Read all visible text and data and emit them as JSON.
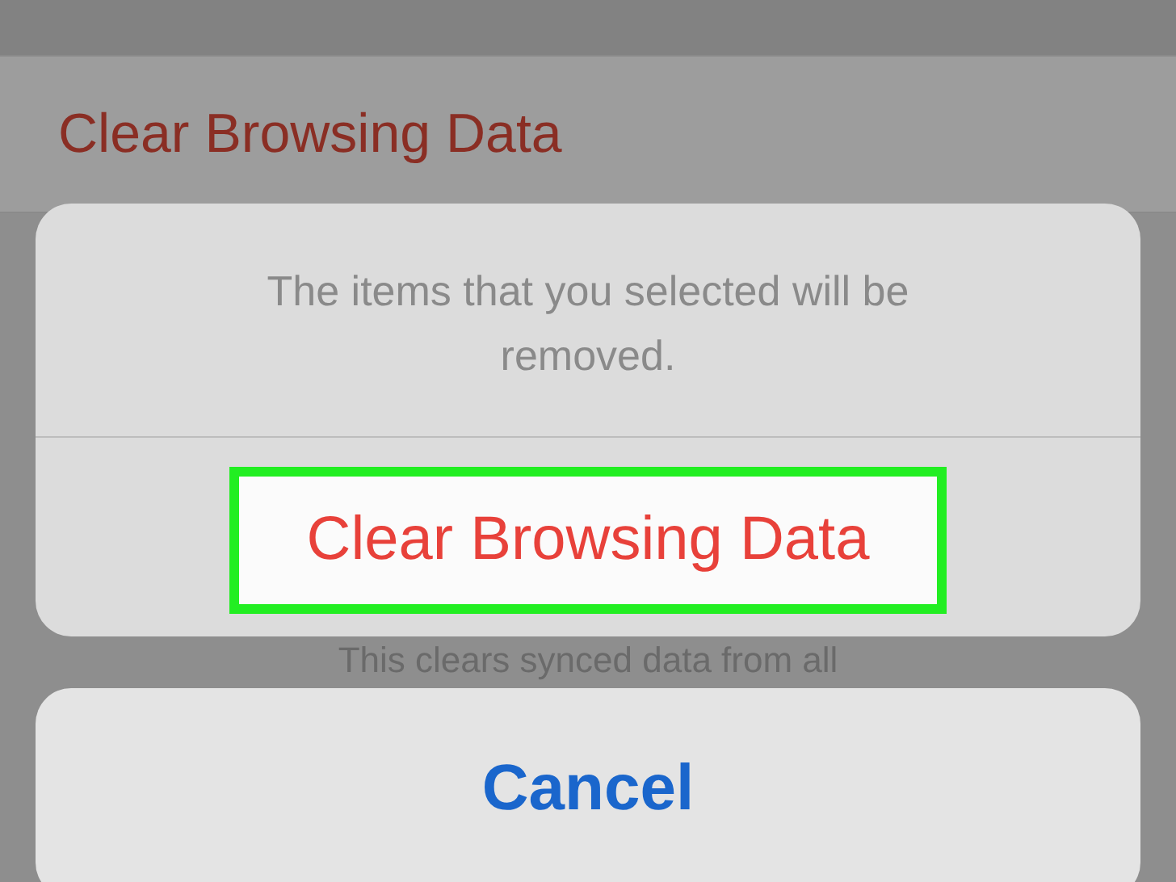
{
  "background_row": {
    "label": "Clear Browsing Data"
  },
  "action_sheet": {
    "message": "The items that you selected will be removed.",
    "actions": [
      {
        "label": "Clear Browsing Data",
        "kind": "destructive",
        "highlighted": true
      }
    ]
  },
  "background_note": "This clears synced data from all",
  "cancel_button": {
    "label": "Cancel"
  }
}
